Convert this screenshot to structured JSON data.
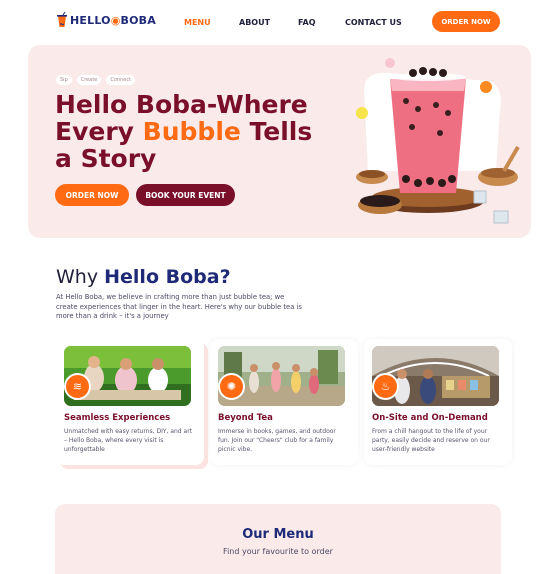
{
  "nav": {
    "logo": {
      "part1": "HELLO",
      "part2": "BOBA",
      "mark": "cup-logo-icon"
    },
    "links": [
      {
        "label": "MENU",
        "active": true
      },
      {
        "label": "ABOUT",
        "active": false
      },
      {
        "label": "FAQ",
        "active": false
      },
      {
        "label": "CONTACT US",
        "active": false
      }
    ],
    "order_label": "ORDER NOW"
  },
  "hero": {
    "chips": [
      "Sip",
      "Create",
      "Connect"
    ],
    "title_line1": "Hello Boba-Where",
    "title_line2_a": "Every ",
    "title_line2_hl": "Bubble",
    "title_line2_b": " Tells",
    "title_line3": "a Story",
    "order_label": "ORDER NOW",
    "book_label": "BOOK YOUR EVENT",
    "image": "boba-drink-image"
  },
  "why": {
    "title_a": "Why ",
    "title_b": "Hello Boba?",
    "description": "At Hello Boba, we believe in crafting more than just bubble tea; we create experiences that linger in the heart. Here's why our bubble tea is more than a drink – it's a journey",
    "cards": [
      {
        "title": "Seamless Experiences",
        "text": "Unmatched with easy returns, DIY, and art – Hello Boba, where every visit is unforgettable",
        "icon": "waves-icon"
      },
      {
        "title": "Beyond Tea",
        "text": "Immerse in books, games, and outdoor fun. Join our \"Cheers\" club for a family picnic vibe.",
        "icon": "celebration-icon"
      },
      {
        "title": "On-Site and On-Demand",
        "text": "From a chill hangout to the life of your party, easily decide and reserve on our user-friendly website",
        "icon": "party-icon"
      }
    ]
  },
  "menu": {
    "title": "Our Menu",
    "subtitle": "Find your favourite to order"
  },
  "colors": {
    "accent": "#ff6a13",
    "maroon": "#7a0f2a",
    "navy": "#1e2a78",
    "hero_bg": "#fbeaea"
  }
}
